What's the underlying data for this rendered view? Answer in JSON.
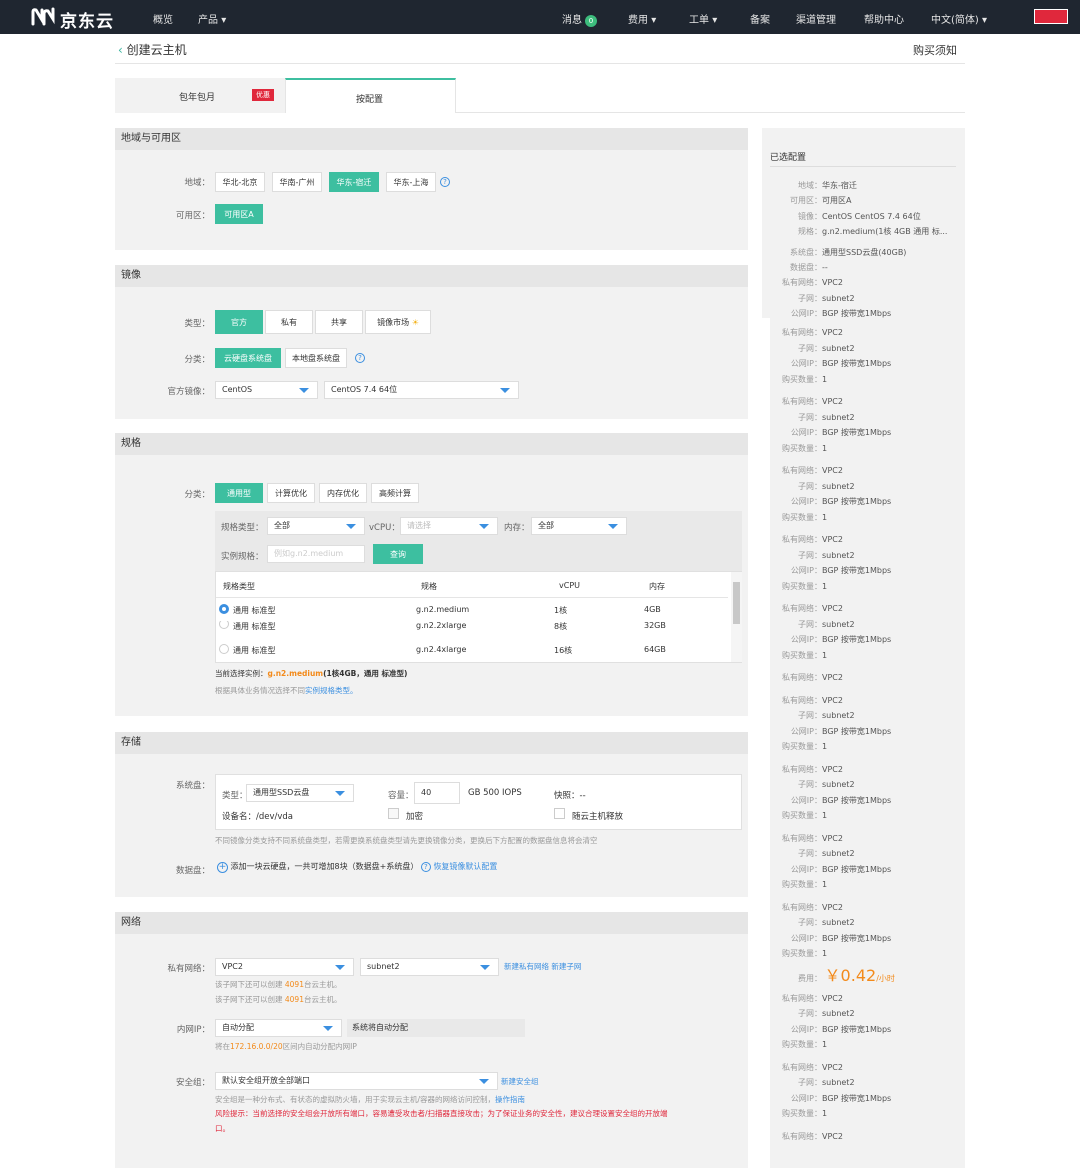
{
  "topbar": {
    "logo": "京东云",
    "nav": [
      "概览",
      "产品"
    ],
    "right": [
      "消息",
      "费用",
      "工单",
      "备案",
      "渠道管理",
      "帮助中心",
      "中文(简体)"
    ],
    "msg_count": "0"
  },
  "page": {
    "title": "创建云主机",
    "buy_notice": "购买须知"
  },
  "tabs": {
    "monthly": "包年包月",
    "promo": "优惠",
    "ondemand": "按配置"
  },
  "region": {
    "head": "地域与可用区",
    "region_label": "地域：",
    "regions": [
      "华北-北京",
      "华南-广州",
      "华东-宿迁",
      "华东-上海"
    ],
    "selected": "华东-宿迁",
    "az_label": "可用区：",
    "az": "可用区A"
  },
  "image": {
    "head": "镜像",
    "type_label": "类型：",
    "types": [
      "官方",
      "私有",
      "共享",
      "镜像市场"
    ],
    "cat_label": "分类：",
    "cats": [
      "云硬盘系统盘",
      "本地盘系统盘"
    ],
    "img_label": "官方镜像：",
    "os": "CentOS",
    "version": "CentOS 7.4 64位"
  },
  "spec": {
    "head": "规格",
    "cat_label": "分类：",
    "cats": [
      "通用型",
      "计算优化",
      "内存优化",
      "高频计算"
    ],
    "type_label": "规格类型：",
    "type_val": "全部",
    "vcpu_label": "vCPU：",
    "vcpu_ph": "请选择",
    "mem_label": "内存：",
    "mem_val": "全部",
    "inst_label": "实例规格：",
    "inst_ph": "例如g.n2.medium",
    "query": "查询",
    "cols": [
      "规格类型",
      "规格",
      "vCPU",
      "内存"
    ],
    "rows": [
      [
        "通用 标准型",
        "g.n2.medium",
        "1核",
        "4GB"
      ],
      [
        "通用 标准型",
        "g.n2.2xlarge",
        "8核",
        "32GB"
      ],
      [
        "通用 标准型",
        "g.n2.4xlarge",
        "16核",
        "64GB"
      ]
    ],
    "current_prefix": "当前选择实例：",
    "current_name": "g.n2.medium",
    "current_detail": "(1核4GB，通用 标准型)",
    "hint_prefix": "根据具体业务情况选择不同",
    "hint_link": "实例规格类型。"
  },
  "storage": {
    "head": "存储",
    "sys_label": "系统盘：",
    "type_label": "类型：",
    "type_val": "通用型SSD云盘",
    "cap_label": "容量：",
    "cap_val": "40",
    "cap_unit": "GB  500 IOPS",
    "snap": "快照：--",
    "dev": "设备名：/dev/vda",
    "encrypt": "加密",
    "release": "随云主机释放",
    "note": "不同镜像分类支持不同系统盘类型，若需更换系统盘类型请先更换镜像分类，更换后下方配置的数据盘信息将会清空",
    "data_label": "数据盘：",
    "add": "添加一块云硬盘，一共可增加8块（数据盘+系统盘）",
    "restore": "恢复镜像默认配置"
  },
  "network": {
    "head": "网络",
    "vpc_label": "私有网络：",
    "vpc": "VPC2",
    "subnet": "subnet2",
    "new_links": "新建私有网络 新建子网",
    "n1_pre": "该子网下还可以创建 ",
    "n1_num": "4091",
    "n1_post": "台云主机。",
    "ip_label": "内网IP：",
    "ip_val": "自动分配",
    "ip_auto": "系统将自动分配",
    "ip_note_pre": "将在",
    "ip_range": "172.16.0.0/20",
    "ip_note_post": "区间内自动分配内网IP",
    "sg_label": "安全组：",
    "sg_val": "默认安全组开放全部端口",
    "sg_new": "新建安全组",
    "sg_note": "安全组是一种分布式、有状态的虚拟防火墙，用于实现云主机/容器的网络访问控制，",
    "sg_guide": "操作指南",
    "risk": "风险提示：当前选择的安全组会开放所有端口，容易遭受攻击者/扫描器直接攻击；为了保证业务的安全性，建议合理设置安全组的开放端",
    "risk2": "口。"
  },
  "summary": {
    "title": "已选配置",
    "items": [
      [
        "地域：",
        "华东-宿迁"
      ],
      [
        "可用区：",
        "可用区A"
      ],
      [
        "镜像：",
        "CentOS CentOS 7.4 64位"
      ],
      [
        "规格：",
        "g.n2.medium(1核 4GB 通用 标..."
      ],
      [
        "系统盘：",
        "通用型SSD云盘(40GB)"
      ],
      [
        "数据盘：",
        "--"
      ],
      [
        "私有网络：",
        "VPC2"
      ],
      [
        "子网：",
        "subnet2"
      ],
      [
        "公网IP：",
        "BGP 按带宽1Mbps"
      ]
    ],
    "vpc_k": "私有网络：",
    "vpc_v": "VPC2",
    "sub_k": "子网：",
    "sub_v": "subnet2",
    "ip_k": "公网IP：",
    "ip_v": "BGP 按带宽1Mbps",
    "qty_k": "购买数量：",
    "qty_v": "1",
    "fee_k": "费用：",
    "price": "￥0.42",
    "per": "/小时"
  }
}
